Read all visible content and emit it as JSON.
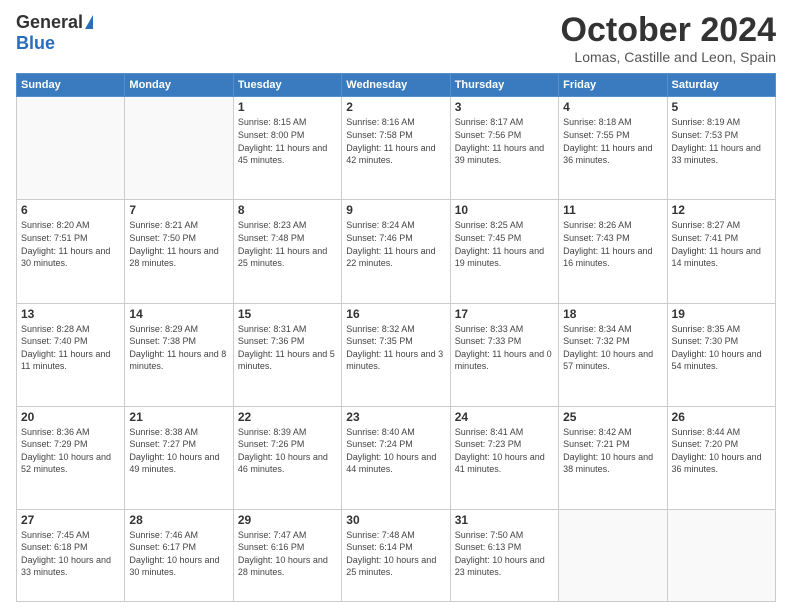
{
  "logo": {
    "general": "General",
    "blue": "Blue"
  },
  "header": {
    "month": "October 2024",
    "location": "Lomas, Castille and Leon, Spain"
  },
  "weekdays": [
    "Sunday",
    "Monday",
    "Tuesday",
    "Wednesday",
    "Thursday",
    "Friday",
    "Saturday"
  ],
  "days": [
    {
      "num": "",
      "info": ""
    },
    {
      "num": "",
      "info": ""
    },
    {
      "num": "1",
      "info": "Sunrise: 8:15 AM\nSunset: 8:00 PM\nDaylight: 11 hours and 45 minutes."
    },
    {
      "num": "2",
      "info": "Sunrise: 8:16 AM\nSunset: 7:58 PM\nDaylight: 11 hours and 42 minutes."
    },
    {
      "num": "3",
      "info": "Sunrise: 8:17 AM\nSunset: 7:56 PM\nDaylight: 11 hours and 39 minutes."
    },
    {
      "num": "4",
      "info": "Sunrise: 8:18 AM\nSunset: 7:55 PM\nDaylight: 11 hours and 36 minutes."
    },
    {
      "num": "5",
      "info": "Sunrise: 8:19 AM\nSunset: 7:53 PM\nDaylight: 11 hours and 33 minutes."
    },
    {
      "num": "6",
      "info": "Sunrise: 8:20 AM\nSunset: 7:51 PM\nDaylight: 11 hours and 30 minutes."
    },
    {
      "num": "7",
      "info": "Sunrise: 8:21 AM\nSunset: 7:50 PM\nDaylight: 11 hours and 28 minutes."
    },
    {
      "num": "8",
      "info": "Sunrise: 8:23 AM\nSunset: 7:48 PM\nDaylight: 11 hours and 25 minutes."
    },
    {
      "num": "9",
      "info": "Sunrise: 8:24 AM\nSunset: 7:46 PM\nDaylight: 11 hours and 22 minutes."
    },
    {
      "num": "10",
      "info": "Sunrise: 8:25 AM\nSunset: 7:45 PM\nDaylight: 11 hours and 19 minutes."
    },
    {
      "num": "11",
      "info": "Sunrise: 8:26 AM\nSunset: 7:43 PM\nDaylight: 11 hours and 16 minutes."
    },
    {
      "num": "12",
      "info": "Sunrise: 8:27 AM\nSunset: 7:41 PM\nDaylight: 11 hours and 14 minutes."
    },
    {
      "num": "13",
      "info": "Sunrise: 8:28 AM\nSunset: 7:40 PM\nDaylight: 11 hours and 11 minutes."
    },
    {
      "num": "14",
      "info": "Sunrise: 8:29 AM\nSunset: 7:38 PM\nDaylight: 11 hours and 8 minutes."
    },
    {
      "num": "15",
      "info": "Sunrise: 8:31 AM\nSunset: 7:36 PM\nDaylight: 11 hours and 5 minutes."
    },
    {
      "num": "16",
      "info": "Sunrise: 8:32 AM\nSunset: 7:35 PM\nDaylight: 11 hours and 3 minutes."
    },
    {
      "num": "17",
      "info": "Sunrise: 8:33 AM\nSunset: 7:33 PM\nDaylight: 11 hours and 0 minutes."
    },
    {
      "num": "18",
      "info": "Sunrise: 8:34 AM\nSunset: 7:32 PM\nDaylight: 10 hours and 57 minutes."
    },
    {
      "num": "19",
      "info": "Sunrise: 8:35 AM\nSunset: 7:30 PM\nDaylight: 10 hours and 54 minutes."
    },
    {
      "num": "20",
      "info": "Sunrise: 8:36 AM\nSunset: 7:29 PM\nDaylight: 10 hours and 52 minutes."
    },
    {
      "num": "21",
      "info": "Sunrise: 8:38 AM\nSunset: 7:27 PM\nDaylight: 10 hours and 49 minutes."
    },
    {
      "num": "22",
      "info": "Sunrise: 8:39 AM\nSunset: 7:26 PM\nDaylight: 10 hours and 46 minutes."
    },
    {
      "num": "23",
      "info": "Sunrise: 8:40 AM\nSunset: 7:24 PM\nDaylight: 10 hours and 44 minutes."
    },
    {
      "num": "24",
      "info": "Sunrise: 8:41 AM\nSunset: 7:23 PM\nDaylight: 10 hours and 41 minutes."
    },
    {
      "num": "25",
      "info": "Sunrise: 8:42 AM\nSunset: 7:21 PM\nDaylight: 10 hours and 38 minutes."
    },
    {
      "num": "26",
      "info": "Sunrise: 8:44 AM\nSunset: 7:20 PM\nDaylight: 10 hours and 36 minutes."
    },
    {
      "num": "27",
      "info": "Sunrise: 7:45 AM\nSunset: 6:18 PM\nDaylight: 10 hours and 33 minutes."
    },
    {
      "num": "28",
      "info": "Sunrise: 7:46 AM\nSunset: 6:17 PM\nDaylight: 10 hours and 30 minutes."
    },
    {
      "num": "29",
      "info": "Sunrise: 7:47 AM\nSunset: 6:16 PM\nDaylight: 10 hours and 28 minutes."
    },
    {
      "num": "30",
      "info": "Sunrise: 7:48 AM\nSunset: 6:14 PM\nDaylight: 10 hours and 25 minutes."
    },
    {
      "num": "31",
      "info": "Sunrise: 7:50 AM\nSunset: 6:13 PM\nDaylight: 10 hours and 23 minutes."
    },
    {
      "num": "",
      "info": ""
    },
    {
      "num": "",
      "info": ""
    }
  ]
}
